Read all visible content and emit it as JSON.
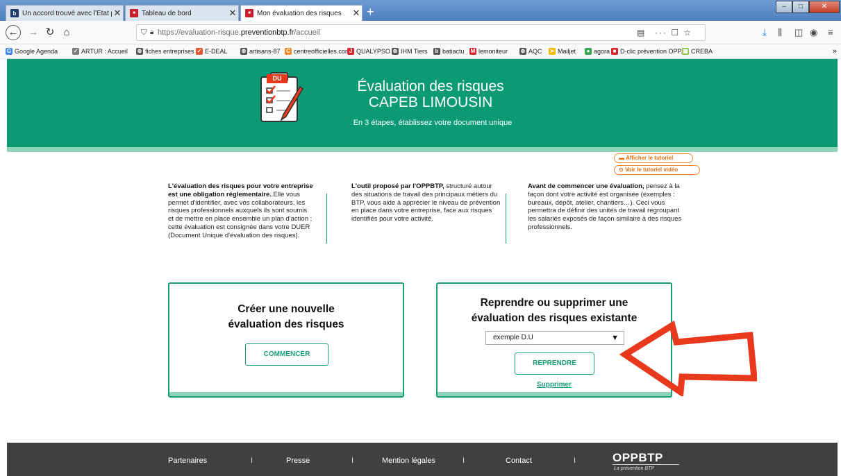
{
  "browser": {
    "tabs": [
      {
        "title": "Un accord trouvé avec l'Etat po",
        "favicon": "b"
      },
      {
        "title": "Tableau de bord",
        "favicon": "■"
      },
      {
        "title": "Mon évaluation des risques",
        "favicon": "■"
      }
    ],
    "new_tab": "+",
    "close_glyph": "✕",
    "url_host_prefix": "https://evaluation-risque.",
    "url_host_main": "preventionbtp.fr",
    "url_path": "/accueil",
    "url_actions": "··· ☐ ☆",
    "bookmarks": [
      {
        "label": "Google Agenda",
        "icon": "G",
        "color": "#4285f4"
      },
      {
        "label": "ARTUR : Accueil",
        "icon": "✓",
        "color": "#7a7a7a"
      },
      {
        "label": "fiches entreprises",
        "icon": "⊕",
        "color": "#555555"
      },
      {
        "label": "E-DEAL",
        "icon": "✓",
        "color": "#e4572e"
      },
      {
        "label": "artisans-87",
        "icon": "⊕",
        "color": "#555555"
      },
      {
        "label": "centreofficielles.com",
        "icon": "C",
        "color": "#f08a24"
      },
      {
        "label": "QUALYPSO",
        "icon": "J",
        "color": "#d9232d"
      },
      {
        "label": "IHM Tiers",
        "icon": "⊕",
        "color": "#555555"
      },
      {
        "label": "batiactu",
        "icon": "b",
        "color": "#555555"
      },
      {
        "label": "lemoniteur",
        "icon": "M",
        "color": "#d9232d"
      },
      {
        "label": "AQC",
        "icon": "⊕",
        "color": "#555555"
      },
      {
        "label": "Mailjet",
        "icon": "➤",
        "color": "#f5b800"
      },
      {
        "label": "agora",
        "icon": "●",
        "color": "#3aa757"
      },
      {
        "label": "D-clic prévention OPP...",
        "icon": "■",
        "color": "#d9232d"
      },
      {
        "label": "CREBA",
        "icon": "▦",
        "color": "#8bc34a"
      }
    ],
    "bookmarks_more": "»"
  },
  "hero": {
    "badge": "DU",
    "title_line1": "Évaluation des risques",
    "title_line2": "CAPEB LIMOUSIN",
    "subtitle": "En 3 étapes, établissez votre document unique"
  },
  "tutorial": {
    "show_tutorial": "Afficher le tutoriel",
    "show_video": "Voir le tutoriel vidéo"
  },
  "intro": {
    "col1_bold": "L'évaluation des risques pour votre entreprise est une obligation réglementaire.",
    "col1_text": " Elle vous permet d'identifier, avec vos collaborateurs, les risques professionnels auxquels ils sont soumis et de mettre en place ensemble un plan d'action ; cette évaluation est consignée dans votre DUER (Document Unique d'évaluation des risques).",
    "col2_bold": "L'outil proposé par l'OPPBTP,",
    "col2_text": " structuré autour des situations de travail des principaux métiers du BTP, vous aide à apprécier le niveau de prévention en place dans votre entreprise, face aux risques identifiés pour votre activité.",
    "col3_bold": "Avant de commencer une évaluation,",
    "col3_text": " pensez à la façon dont votre activité est organisée (exemples : bureaux, dépôt, atelier, chantiers…). Ceci vous permettra de définir des unités de travail regroupant les salariés exposés de façon similaire à des risques professionnels."
  },
  "card_new": {
    "title_line1": "Créer une nouvelle",
    "title_line2": "évaluation des risques",
    "button": "COMMENCER"
  },
  "card_resume": {
    "title_line1": "Reprendre ou supprimer une",
    "title_line2": "évaluation des risques existante",
    "select_value": "exemple D.U",
    "button": "REPRENDRE",
    "delete_link": "Supprimer"
  },
  "footer": {
    "links": [
      "Partenaires",
      "Presse",
      "Mention légales",
      "Contact"
    ],
    "separator": "I",
    "logo": "OPPBTP",
    "tagline": "La prévention BTP"
  },
  "colors": {
    "brand_green": "#0b9a74",
    "light_green": "#8fd3b7",
    "arrow_red": "#e8391d",
    "tutorial_orange": "#e76f12",
    "footer_gray": "#404040"
  }
}
